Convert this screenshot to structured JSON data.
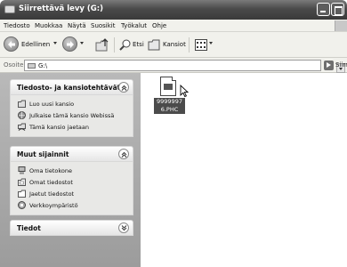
{
  "window": {
    "title": "Siirrettävä levy (G:)"
  },
  "menu": {
    "items": [
      "Tiedosto",
      "Muokkaa",
      "Näytä",
      "Suosikit",
      "Työkalut",
      "Ohje"
    ]
  },
  "toolbar": {
    "back_label": "Edellinen",
    "search_label": "Etsi",
    "folders_label": "Kansiot"
  },
  "address": {
    "label": "Osoite",
    "value": "G:\\",
    "go_label": "Siirr"
  },
  "taskpane": {
    "file_tasks": {
      "title": "Tiedosto- ja kansiotehtävät",
      "items": [
        "Luo uusi kansio",
        "Julkaise tämä kansio Webissä",
        "Tämä kansio jaetaan"
      ]
    },
    "other_places": {
      "title": "Muut sijainnit",
      "items": [
        "Oma tietokone",
        "Omat tiedostot",
        "Jaetut tiedostot",
        "Verkkoympäristö"
      ]
    },
    "details": {
      "title": "Tiedot"
    }
  },
  "content": {
    "files": [
      {
        "name": "99999976.PHC",
        "selected": true
      }
    ]
  },
  "colors": {
    "title_bar": "#4a4a4a",
    "task_pane": "#a8a8a8",
    "selection": "#4b4b4b"
  }
}
